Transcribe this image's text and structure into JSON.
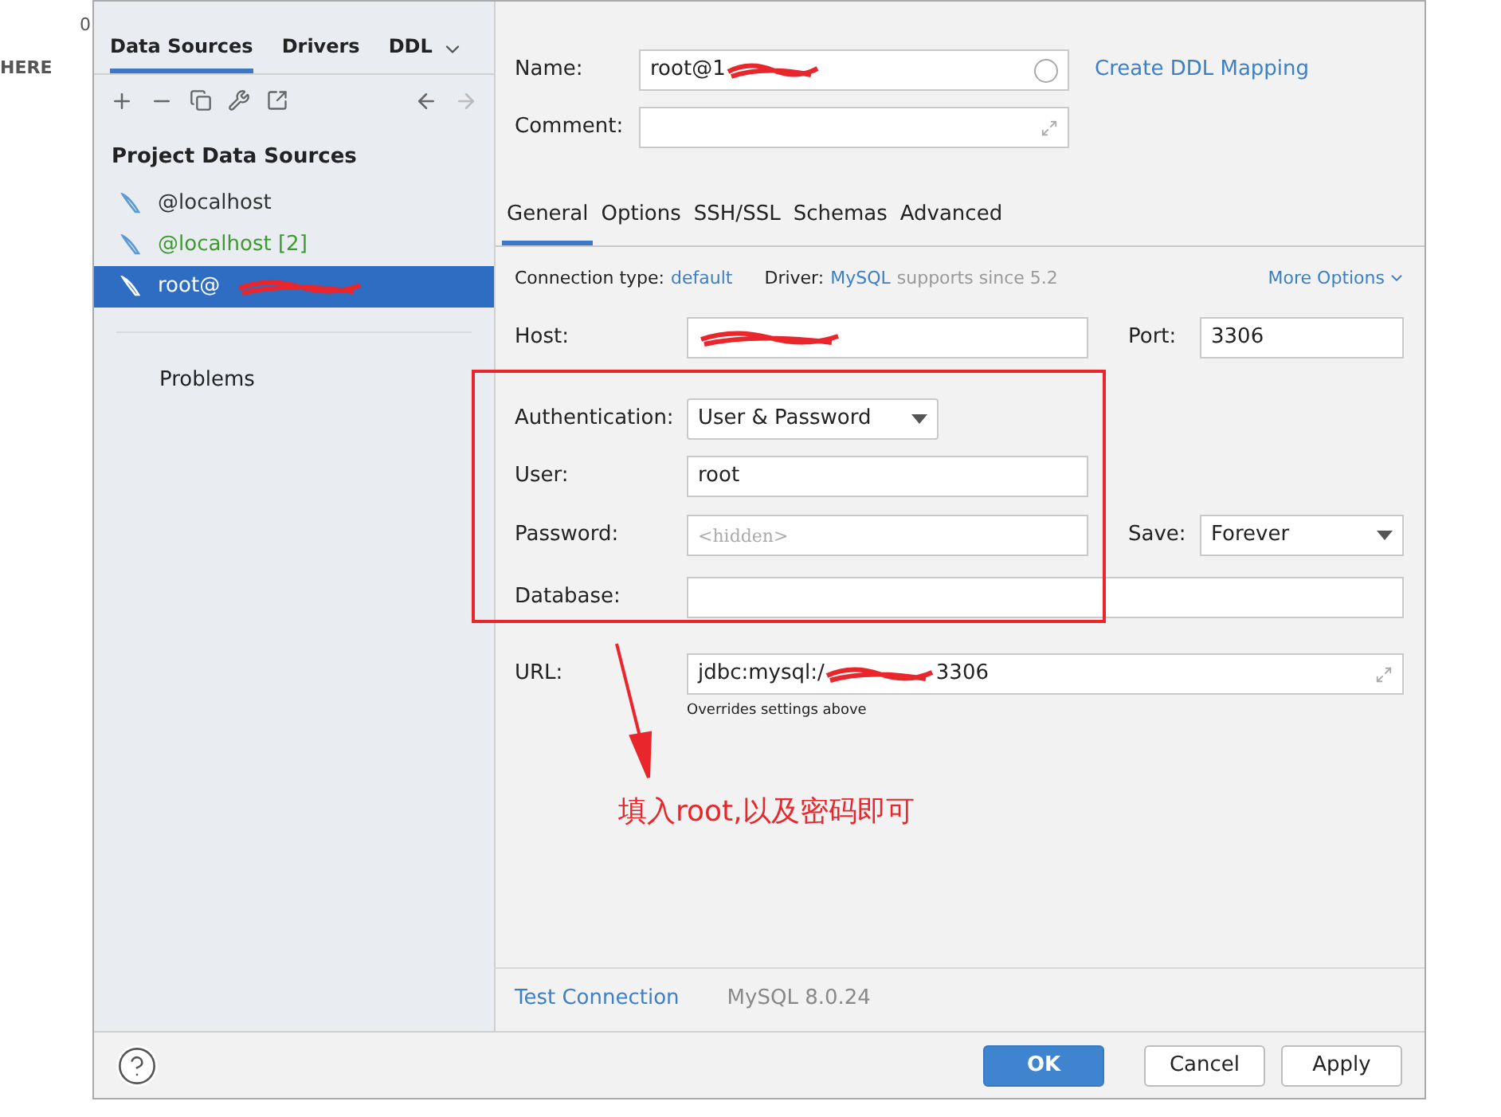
{
  "backdrop": {
    "texts": [
      "0",
      "HERE"
    ]
  },
  "sidebar": {
    "tabs": [
      {
        "label": "Data Sources",
        "selected": true
      },
      {
        "label": "Drivers",
        "selected": false
      },
      {
        "label": "DDL",
        "selected": false
      }
    ],
    "section_title": "Project Data Sources",
    "items": [
      {
        "label": "@localhost",
        "selected": false,
        "color": "#333333"
      },
      {
        "label": "@localhost [2]",
        "selected": false,
        "color": "#3c9a2e"
      },
      {
        "label": "root@",
        "selected": true,
        "color": "#ffffff"
      }
    ],
    "problems": "Problems"
  },
  "form": {
    "name_label": "Name:",
    "name_value": "root@1",
    "ddl_link": "Create DDL Mapping",
    "comment_label": "Comment:",
    "tabs": [
      {
        "label": "General",
        "selected": true
      },
      {
        "label": "Options",
        "selected": false
      },
      {
        "label": "SSH/SSL",
        "selected": false
      },
      {
        "label": "Schemas",
        "selected": false
      },
      {
        "label": "Advanced",
        "selected": false
      }
    ],
    "connection_type_label": "Connection type:",
    "connection_type_value": "default",
    "driver_label": "Driver:",
    "driver_value": "MySQL",
    "driver_note": "supports since 5.2",
    "more_options": "More Options",
    "host_label": "Host:",
    "port_label": "Port:",
    "port_value": "3306",
    "auth_label": "Authentication:",
    "auth_value": "User & Password",
    "user_label": "User:",
    "user_value": "root",
    "password_label": "Password:",
    "password_placeholder": "<hidden>",
    "save_label": "Save:",
    "save_value": "Forever",
    "database_label": "Database:",
    "url_label": "URL:",
    "url_prefix": "jdbc:mysql:/",
    "url_suffix": "3306",
    "url_note": "Overrides settings above"
  },
  "footer": {
    "test_connection": "Test Connection",
    "version": "MySQL 8.0.24",
    "buttons": [
      {
        "label": "OK",
        "kind": "primary"
      },
      {
        "label": "Cancel",
        "kind": "normal"
      },
      {
        "label": "Apply",
        "kind": "normal"
      }
    ]
  },
  "annotation": {
    "text": "填入root,以及密码即可"
  }
}
